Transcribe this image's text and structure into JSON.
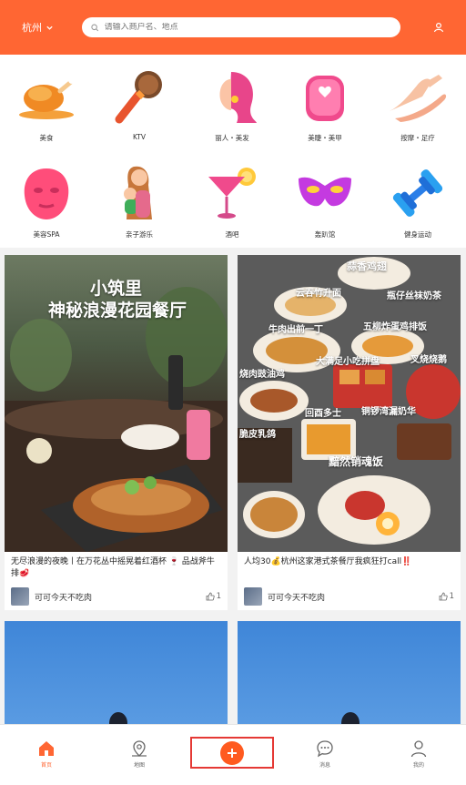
{
  "header": {
    "city": "杭州",
    "search_placeholder": "请输入商户名、地点"
  },
  "categories": [
    {
      "label": "美食",
      "icon": "roast-chicken-icon"
    },
    {
      "label": "KTV",
      "icon": "microphone-icon"
    },
    {
      "label": "丽人・美发",
      "icon": "hair-beauty-icon"
    },
    {
      "label": "美睫・美甲",
      "icon": "nail-icon"
    },
    {
      "label": "按摩・足疗",
      "icon": "massage-hands-icon"
    },
    {
      "label": "美容SPA",
      "icon": "face-mask-icon"
    },
    {
      "label": "亲子游乐",
      "icon": "parent-child-icon"
    },
    {
      "label": "酒吧",
      "icon": "cocktail-icon"
    },
    {
      "label": "轰趴馆",
      "icon": "party-mask-icon"
    },
    {
      "label": "健身运动",
      "icon": "dumbbell-icon"
    }
  ],
  "feed": [
    {
      "image_text_1": "小筑里",
      "image_text_2": "神秘浪漫花园餐厅",
      "title": "无尽浪漫的夜晚丨在万花丛中摇晃着红酒杯 🍷 品战斧牛排🥩",
      "author": "可可今天不吃肉",
      "likes": "1"
    },
    {
      "image_labels": [
        "蒜香鸡翅",
        "云吞竹升面",
        "瓶仔丝袜奶茶",
        "牛肉出前一丁",
        "五柳炸蛋鸡排饭",
        "大满足小吃拼盘",
        "叉烧烧鹅",
        "烧肉豉油鸡",
        "回酉多士",
        "铜锣湾漏奶华",
        "脆皮乳鸽",
        "黯然销魂饭"
      ],
      "title": "人均30💰杭州这家港式茶餐厅我疯狂打call‼️",
      "author": "可可今天不吃肉",
      "likes": "1"
    }
  ],
  "bottom_nav": [
    {
      "label": "首页",
      "icon": "home-icon"
    },
    {
      "label": "地图",
      "icon": "map-pin-icon"
    },
    {
      "label": "",
      "icon": "plus-icon"
    },
    {
      "label": "消息",
      "icon": "message-icon"
    },
    {
      "label": "我的",
      "icon": "person-icon"
    }
  ],
  "colors": {
    "brand": "#ff6633",
    "highlight_border": "#e53935"
  }
}
